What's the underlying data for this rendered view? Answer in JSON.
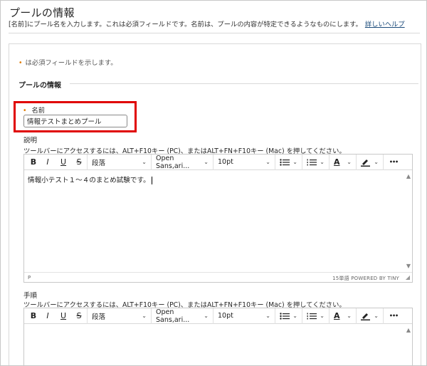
{
  "page": {
    "title": "プールの情報",
    "description_prefix": "[名前]",
    "description_text": "にプール名を入力します。これは必須フィールドです。名前は、プールの内容が特定できるようなものにします。",
    "help_link": "詳しいヘルプ"
  },
  "form": {
    "required_note": "は必須フィールドを示します。",
    "section_title": "プールの情報",
    "name_label": "名前",
    "name_value": "情報テストまとめプール",
    "description_label": "説明",
    "instructions_label": "手順",
    "toolbar_hint": "ツールバーにアクセスするには、ALT+F10キー (PC)、またはALT+FN+F10キー (Mac) を押してください。"
  },
  "editor1": {
    "paragraph": "段落",
    "font": "Open Sans,ari...",
    "size": "10pt",
    "content": "情報小テスト１～４のまとめ試験です。",
    "path": "P",
    "word_count": "15単語",
    "powered_by": "POWERED BY TINY"
  },
  "editor2": {
    "paragraph": "段落",
    "font": "Open Sans,ari...",
    "size": "10pt"
  },
  "toolbar": {
    "bold": "B",
    "italic": "I",
    "underline": "U",
    "strike": "S",
    "text_color": "A",
    "more": "•••"
  },
  "icons": {
    "required": "asterisk",
    "bullet_list": "bullet-list-icon",
    "numbered_list": "numbered-list-icon",
    "highlight": "highlighter-icon"
  },
  "colors": {
    "required_star": "#e07b00",
    "highlight_box": "#e00000",
    "link": "#1a4a7a"
  }
}
